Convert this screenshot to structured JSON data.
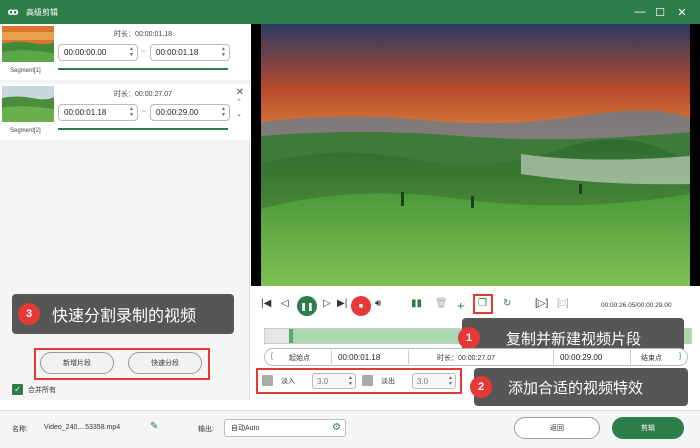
{
  "window": {
    "title": "高级剪辑",
    "controls": [
      "—",
      "☐",
      "✕"
    ]
  },
  "segments": [
    {
      "label": "Segment[1]",
      "duration": "时长：00:00:01.18",
      "start": "00:00:00.00",
      "end": "00:00:01.18",
      "tilde": "~"
    },
    {
      "label": "Segment[2]",
      "duration": "时长：00:00:27.07",
      "start": "00:00:01.18",
      "end": "00:00:29.00",
      "tilde": "~"
    }
  ],
  "annotations": {
    "a1": {
      "num": "1",
      "text": "复制并新建视频片段"
    },
    "a2": {
      "num": "2",
      "text": "添加合适的视频特效"
    },
    "a3": {
      "num": "3",
      "text": "快速分割录制的视频"
    }
  },
  "buttons": {
    "new_segment": "新增片段",
    "quick_split": "快速分段",
    "back": "返回",
    "edit": "剪辑"
  },
  "merge_all": "合并所有",
  "player": {
    "time_readout": "00:00:26.05/00:00:29.00"
  },
  "trim": {
    "start_label": "起始点",
    "start_value": "00:00:01.18",
    "duration_label": "时长：00:00:27.07",
    "end_value": "00:00:29.00",
    "end_label": "结束点"
  },
  "effects": {
    "fade_in_label": "淡入",
    "fade_in_value": "3.0",
    "fade_out_label": "淡出",
    "fade_out_value": "3.0"
  },
  "bottom": {
    "name_label": "名称:",
    "file_name": "Video_240....53358.mp4",
    "output_label": "输出:",
    "output_value": "自动Auto"
  },
  "colors": {
    "accent": "#2d7d4a",
    "annotation_red": "#e53935",
    "annotation_bg": "#565656"
  }
}
